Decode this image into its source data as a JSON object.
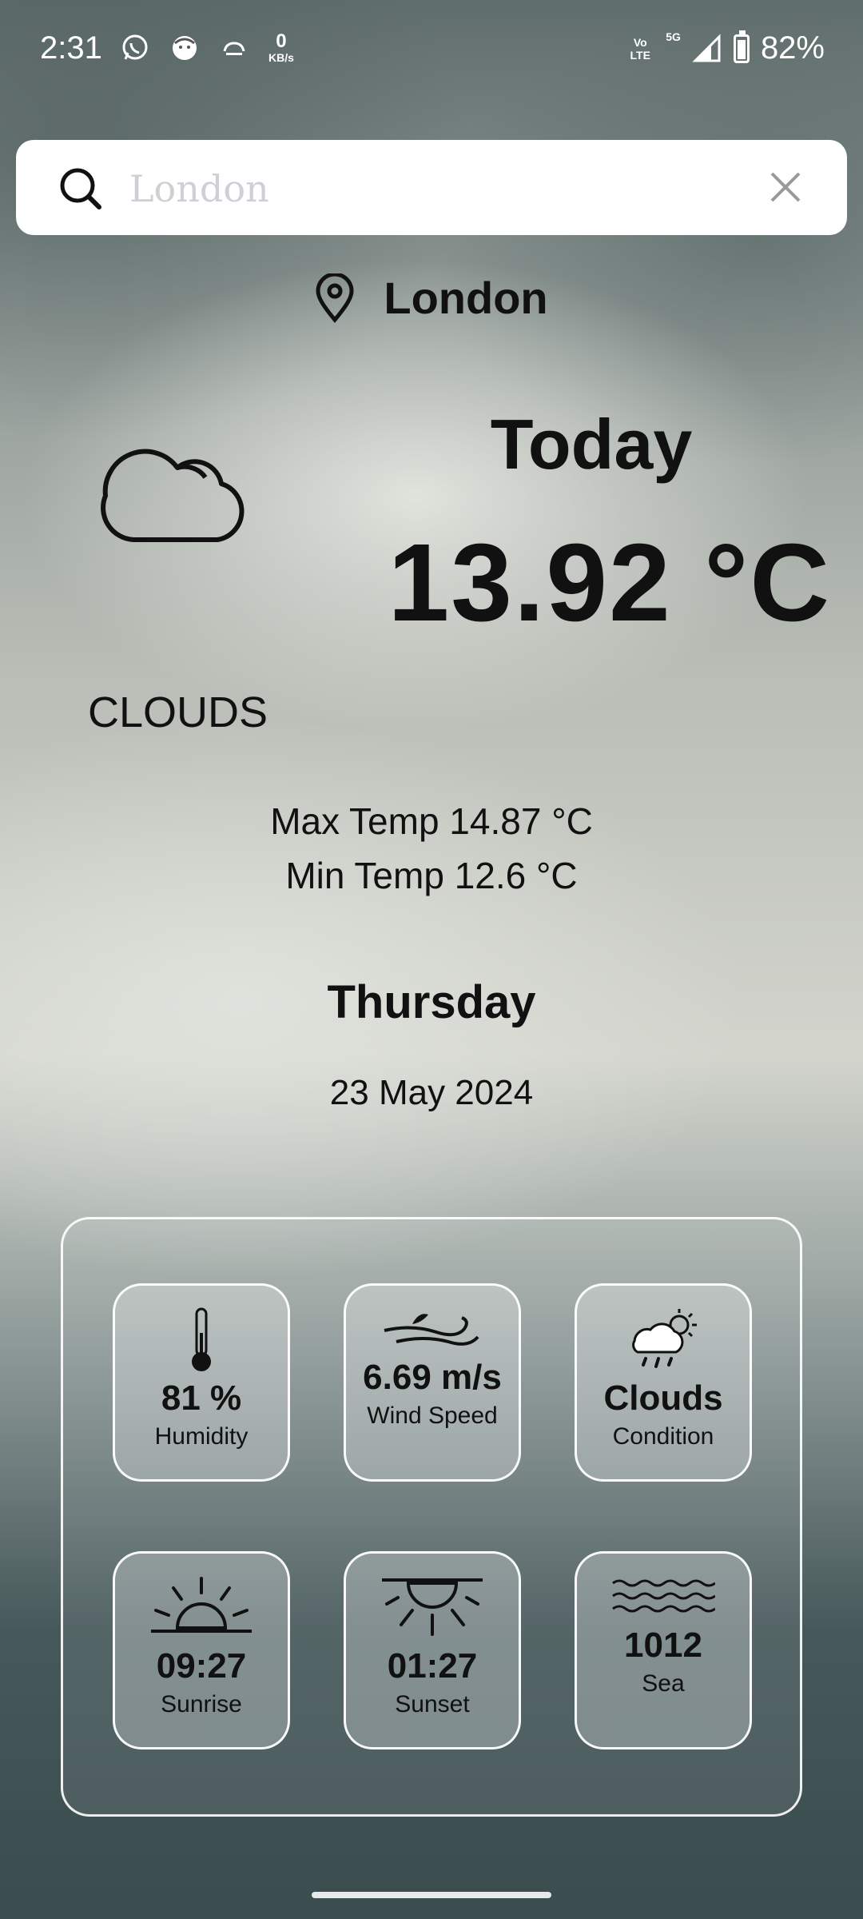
{
  "status_bar": {
    "time": "2:31",
    "net_speed_value": "0",
    "net_speed_unit": "KB/s",
    "volte": "Vo LTE",
    "network": "5G",
    "battery": "82%"
  },
  "search": {
    "placeholder": "London"
  },
  "location": {
    "city": "London"
  },
  "weather": {
    "today_label": "Today",
    "temperature": "13.92 °C",
    "condition": "CLOUDS",
    "max_temp": "Max Temp 14.87 °C",
    "min_temp": "Min Temp 12.6 °C",
    "day": "Thursday",
    "date": "23 May 2024"
  },
  "details": [
    {
      "icon": "thermometer-icon",
      "value": "81 %",
      "label": "Humidity"
    },
    {
      "icon": "wind-icon",
      "value": "6.69 m/s",
      "label": "Wind Speed"
    },
    {
      "icon": "cloud-sun-rain-icon",
      "value": "Clouds",
      "label": "Condition"
    },
    {
      "icon": "sunrise-icon",
      "value": "09:27",
      "label": "Sunrise"
    },
    {
      "icon": "sunset-icon",
      "value": "01:27",
      "label": "Sunset"
    },
    {
      "icon": "waves-icon",
      "value": "1012",
      "label": "Sea"
    }
  ]
}
